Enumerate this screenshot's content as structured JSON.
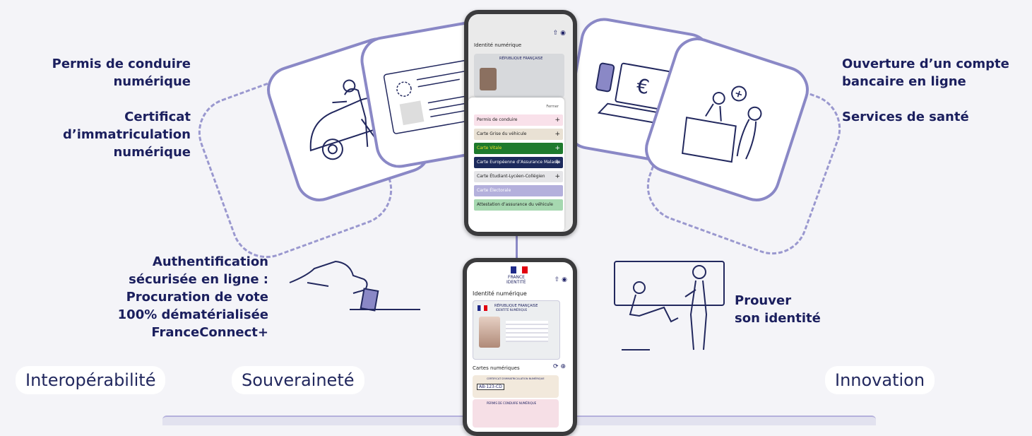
{
  "labels": {
    "permis": [
      "Permis de conduire",
      "numérique"
    ],
    "certificat": [
      "Certificat",
      "d’immatriculation",
      "numérique"
    ],
    "ouverture": [
      "Ouverture d’un compte",
      "bancaire en ligne"
    ],
    "sante": "Services de santé",
    "authentification": [
      "Authentification",
      "sécurisée en ligne :",
      "Procuration de vote",
      "100% dématérialisée",
      "FranceConnect+"
    ],
    "prouver": [
      "Prouver",
      "son identité"
    ]
  },
  "pills": {
    "interop": "Interopérabilité",
    "souverainete": "Souveraineté",
    "innovation": "Innovation"
  },
  "top_phone": {
    "title": "Identité numérique",
    "id_header": "RÉPUBLIQUE FRANÇAISE",
    "panel_tag": "Fermer",
    "items": [
      {
        "label": "Permis de conduire",
        "color": "#f9e1ea",
        "plus": "+"
      },
      {
        "label": "Carte Grise du véhicule",
        "color": "#e9e1d4",
        "plus": "+"
      },
      {
        "label": "Carte Vitale",
        "color": "#1e7a2d",
        "plus": "+"
      },
      {
        "label": "Carte Européenne d’Assurance Maladie",
        "color": "#1c2a5c",
        "plus": "+"
      },
      {
        "label": "Carte Étudiant-Lycéen-Collégien",
        "color": "#e5e5e8",
        "plus": "+"
      },
      {
        "label": "Carte Électorale",
        "color": "#b4b0dc",
        "plus": ""
      },
      {
        "label": "Attestation d’assurance du véhicule",
        "color": "#a6d8b0",
        "plus": ""
      }
    ]
  },
  "bottom_phone": {
    "brand": [
      "FRANCE",
      "IDENTITÉ"
    ],
    "title": "Identité numérique",
    "id_header": [
      "RÉPUBLIQUE FRANÇAISE",
      "IDENTITÉ NUMÉRIQUE"
    ],
    "cards_title": "Cartes numériques",
    "card1": "CERTIFICAT D'IMMATRICULATION NUMÉRIQUE",
    "plate": "AB-123-CD",
    "card2": "PERMIS DE CONDUIRE NUMÉRIQUE"
  },
  "icons": {
    "euro": "€",
    "cross": "+"
  }
}
